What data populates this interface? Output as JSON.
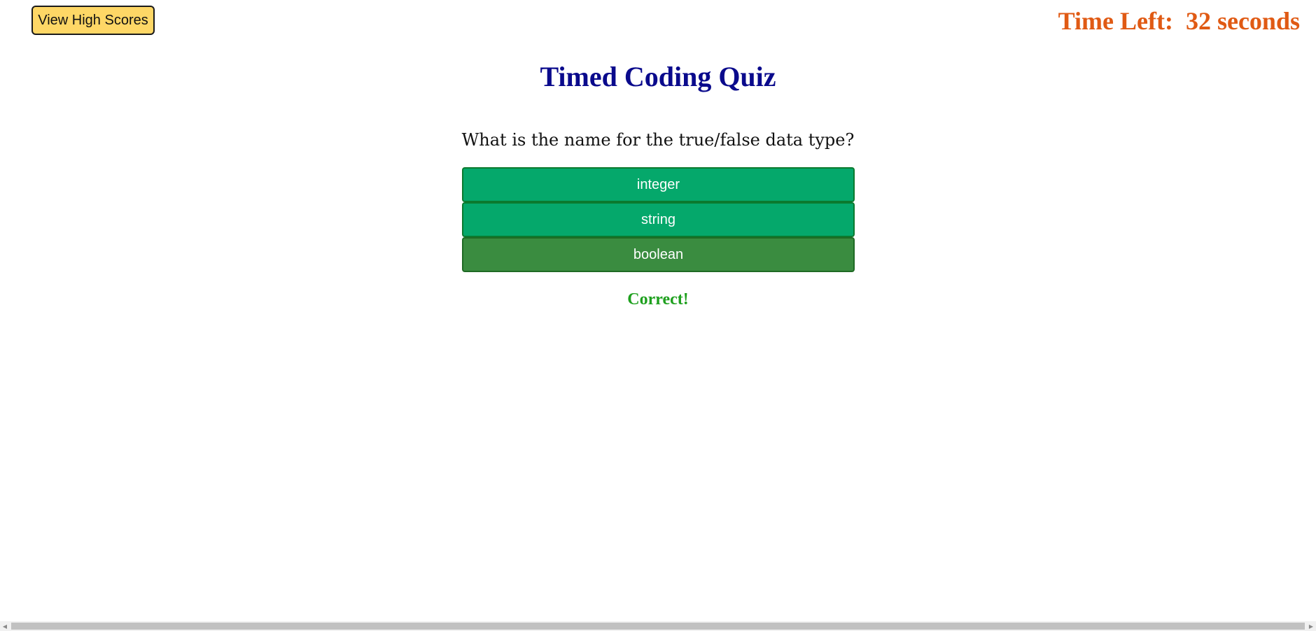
{
  "header": {
    "high_scores_label": "View High Scores",
    "timer_prefix": "Time Left:",
    "timer_value": "32",
    "timer_unit": "seconds"
  },
  "quiz": {
    "title": "Timed Coding Quiz",
    "question": "What is the name for the true/false data type?",
    "choices": [
      {
        "label": "integer"
      },
      {
        "label": "string"
      },
      {
        "label": "boolean"
      }
    ],
    "selected_choice": "boolean",
    "feedback": "Correct!"
  },
  "colors": {
    "choice_bg": "#05a86b",
    "choice_selected_bg": "#3a8c40",
    "title": "#0a0a8c",
    "timer": "#e05a14",
    "feedback": "#1ea01e",
    "high_scores_bg": "#fed766"
  }
}
